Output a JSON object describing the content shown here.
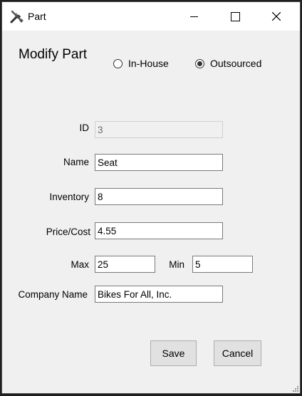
{
  "window": {
    "title": "Part",
    "icon": "tools-icon"
  },
  "form": {
    "heading": "Modify Part",
    "radio_inhouse_label": "In-House",
    "radio_outsourced_label": "Outsourced",
    "selected_source": "Outsourced",
    "id_label": "ID",
    "id_value": "3",
    "name_label": "Name",
    "name_value": "Seat",
    "inventory_label": "Inventory",
    "inventory_value": "8",
    "price_label": "Price/Cost",
    "price_value": "4.55",
    "max_label": "Max",
    "max_value": "25",
    "min_label": "Min",
    "min_value": "5",
    "company_label": "Company Name",
    "company_value": "Bikes For All, Inc."
  },
  "buttons": {
    "save_label": "Save",
    "cancel_label": "Cancel"
  }
}
